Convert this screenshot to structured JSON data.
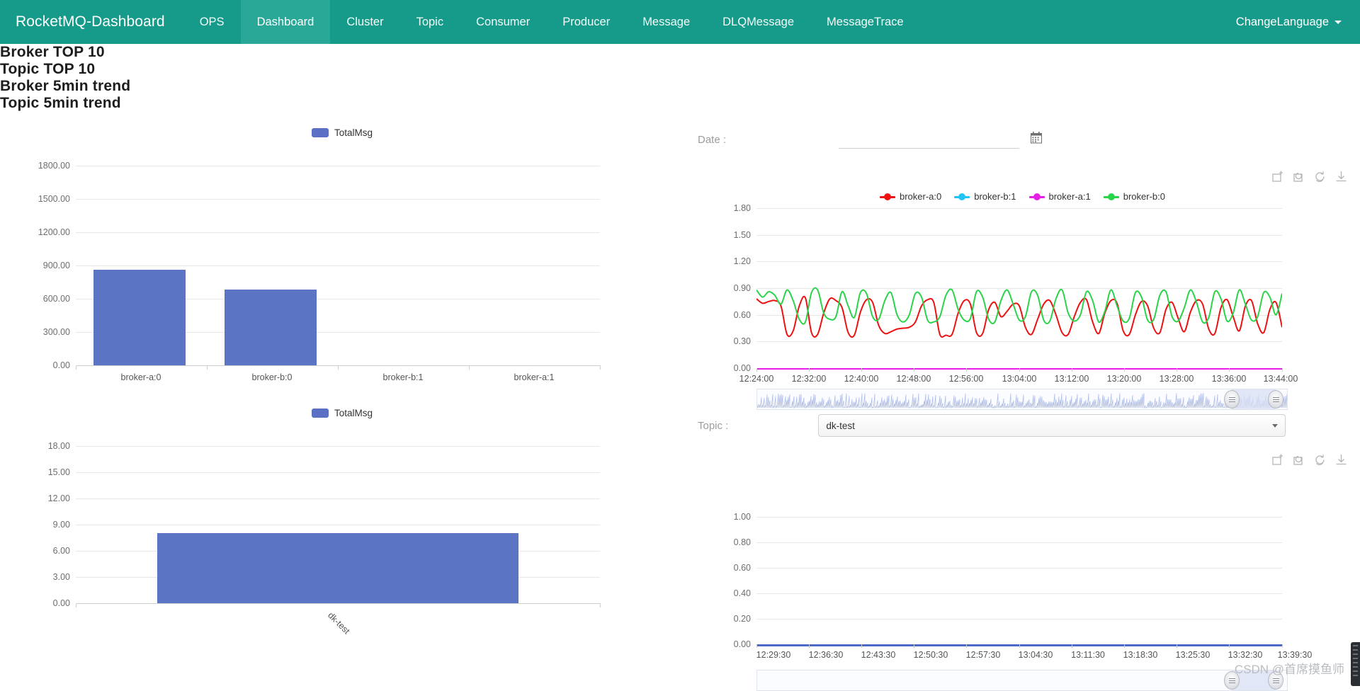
{
  "navbar": {
    "brand": "RocketMQ-Dashboard",
    "items": [
      {
        "label": "OPS",
        "active": false
      },
      {
        "label": "Dashboard",
        "active": true
      },
      {
        "label": "Cluster",
        "active": false
      },
      {
        "label": "Topic",
        "active": false
      },
      {
        "label": "Consumer",
        "active": false
      },
      {
        "label": "Producer",
        "active": false
      },
      {
        "label": "Message",
        "active": false
      },
      {
        "label": "DLQMessage",
        "active": false
      },
      {
        "label": "MessageTrace",
        "active": false
      }
    ],
    "language_label": "ChangeLanguage",
    "brand_color": "#169b8a",
    "active_color": "#2aa897"
  },
  "controls": {
    "date_label": "Date :",
    "date_value": "",
    "date_placeholder": "",
    "calendar_icon": "calendar-icon",
    "topic_label": "Topic :",
    "topic_value": "dk-test"
  },
  "toolbox": {
    "icons": [
      "zoom-area-icon",
      "zoom-restore-icon",
      "refresh-icon",
      "download-icon"
    ]
  },
  "chart_data": [
    {
      "id": "broker-top10",
      "type": "bar",
      "title": "Broker TOP 10",
      "legend": [
        "TotalMsg"
      ],
      "legend_color": "#5b74c4",
      "categories": [
        "broker-a:0",
        "broker-b:0",
        "broker-b:1",
        "broker-a:1"
      ],
      "values": [
        860,
        680,
        0,
        0
      ],
      "yticks": [
        "0.00",
        "300.00",
        "600.00",
        "900.00",
        "1200.00",
        "1500.00",
        "1800.00"
      ],
      "ylim": [
        0,
        1800
      ],
      "xlabel": "",
      "ylabel": "",
      "grid": true,
      "legend_position": "top-center"
    },
    {
      "id": "topic-top10",
      "type": "bar",
      "title": "Topic TOP 10",
      "legend": [
        "TotalMsg"
      ],
      "legend_color": "#5b74c4",
      "categories": [
        "dk-test"
      ],
      "values": [
        8
      ],
      "yticks": [
        "0.00",
        "3.00",
        "6.00",
        "9.00",
        "12.00",
        "15.00",
        "18.00"
      ],
      "ylim": [
        0,
        18
      ],
      "xlabel": "",
      "ylabel": "",
      "grid": true,
      "label_rotation": 45,
      "legend_position": "top-center"
    },
    {
      "id": "broker-5min-trend",
      "type": "line",
      "title": "Broker 5min trend",
      "yticks": [
        "0.00",
        "0.30",
        "0.60",
        "0.90",
        "1.20",
        "1.50",
        "1.80"
      ],
      "ylim": [
        0,
        1.8
      ],
      "xticks": [
        "12:24:00",
        "12:32:00",
        "12:40:00",
        "12:48:00",
        "12:56:00",
        "13:04:00",
        "13:12:00",
        "13:20:00",
        "13:28:00",
        "13:36:00",
        "13:44:00"
      ],
      "grid": true,
      "legend_position": "top-center",
      "series": [
        {
          "name": "broker-a:0",
          "color": "#ee1111",
          "values": [
            0.78,
            0.73,
            0.75,
            0.76,
            0.7,
            0.38,
            0.42,
            0.7,
            0.79,
            0.4,
            0.38,
            0.62,
            0.78,
            0.76,
            0.68,
            0.4,
            0.37,
            0.63,
            0.77,
            0.74,
            0.48,
            0.39,
            0.41,
            0.44,
            0.45,
            0.46,
            0.52,
            0.7,
            0.77,
            0.74,
            0.38,
            0.37,
            0.38,
            0.62,
            0.76,
            0.72,
            0.4,
            0.39,
            0.66,
            0.74,
            0.58,
            0.64,
            0.72,
            0.7,
            0.46,
            0.38,
            0.55,
            0.72,
            0.76,
            0.6,
            0.4,
            0.38,
            0.58,
            0.74,
            0.77,
            0.52,
            0.39,
            0.62,
            0.76,
            0.73,
            0.42,
            0.38,
            0.6,
            0.75,
            0.7,
            0.45,
            0.4,
            0.66,
            0.74,
            0.56,
            0.41,
            0.63,
            0.76,
            0.72,
            0.44,
            0.39,
            0.68,
            0.77,
            0.58,
            0.42,
            0.7,
            0.76,
            0.5,
            0.4,
            0.66,
            0.74,
            0.46
          ]
        },
        {
          "name": "broker-b:1",
          "color": "#22c3f5",
          "values": [
            0,
            0,
            0,
            0,
            0,
            0,
            0,
            0,
            0,
            0,
            0,
            0,
            0,
            0,
            0,
            0,
            0,
            0,
            0,
            0,
            0,
            0,
            0,
            0,
            0,
            0,
            0,
            0,
            0,
            0,
            0,
            0,
            0,
            0,
            0,
            0,
            0,
            0,
            0,
            0,
            0,
            0,
            0,
            0,
            0,
            0,
            0,
            0,
            0,
            0,
            0,
            0,
            0,
            0,
            0,
            0,
            0,
            0,
            0,
            0,
            0,
            0,
            0,
            0,
            0,
            0,
            0,
            0,
            0,
            0,
            0,
            0,
            0,
            0,
            0,
            0,
            0,
            0,
            0,
            0,
            0,
            0,
            0,
            0,
            0,
            0,
            0
          ]
        },
        {
          "name": "broker-a:1",
          "color": "#e61ee6",
          "values": [
            0,
            0,
            0,
            0,
            0,
            0,
            0,
            0,
            0,
            0,
            0,
            0,
            0,
            0,
            0,
            0,
            0,
            0,
            0,
            0,
            0,
            0,
            0,
            0,
            0,
            0,
            0,
            0,
            0,
            0,
            0,
            0,
            0,
            0,
            0,
            0,
            0,
            0,
            0,
            0,
            0,
            0,
            0,
            0,
            0,
            0,
            0,
            0,
            0,
            0,
            0,
            0,
            0,
            0,
            0,
            0,
            0,
            0,
            0,
            0,
            0,
            0,
            0,
            0,
            0,
            0,
            0,
            0,
            0,
            0,
            0,
            0,
            0,
            0,
            0,
            0,
            0,
            0,
            0,
            0,
            0,
            0,
            0,
            0,
            0,
            0,
            0
          ]
        },
        {
          "name": "broker-b:0",
          "color": "#2ad44a",
          "values": [
            0.88,
            0.8,
            0.86,
            0.82,
            0.72,
            0.88,
            0.76,
            0.55,
            0.52,
            0.85,
            0.88,
            0.62,
            0.55,
            0.58,
            0.86,
            0.7,
            0.57,
            0.85,
            0.84,
            0.58,
            0.55,
            0.76,
            0.85,
            0.6,
            0.52,
            0.6,
            0.84,
            0.8,
            0.54,
            0.52,
            0.58,
            0.82,
            0.88,
            0.66,
            0.54,
            0.56,
            0.86,
            0.8,
            0.55,
            0.52,
            0.76,
            0.88,
            0.72,
            0.54,
            0.58,
            0.86,
            0.82,
            0.54,
            0.53,
            0.78,
            0.88,
            0.62,
            0.53,
            0.6,
            0.86,
            0.76,
            0.52,
            0.64,
            0.88,
            0.7,
            0.53,
            0.56,
            0.85,
            0.8,
            0.54,
            0.55,
            0.82,
            0.86,
            0.58,
            0.53,
            0.68,
            0.88,
            0.74,
            0.52,
            0.57,
            0.86,
            0.78,
            0.53,
            0.62,
            0.88,
            0.72,
            0.54,
            0.58,
            0.85,
            0.8,
            0.6,
            0.84
          ]
        }
      ]
    },
    {
      "id": "topic-5min-trend",
      "type": "line",
      "title": "Topic 5min trend",
      "yticks": [
        "0.00",
        "0.20",
        "0.40",
        "0.60",
        "0.80",
        "1.00"
      ],
      "ylim": [
        0,
        1.0
      ],
      "xticks": [
        "12:29:30",
        "12:36:30",
        "12:43:30",
        "12:50:30",
        "12:57:30",
        "13:04:30",
        "13:11:30",
        "13:18:30",
        "13:25:30",
        "13:32:30",
        "13:39:30"
      ],
      "grid": true,
      "series": [
        {
          "name": "dk-test",
          "color": "#4a6ac8",
          "values": [
            0,
            0,
            0,
            0,
            0,
            0,
            0,
            0,
            0,
            0,
            0,
            0,
            0,
            0,
            0,
            0,
            0,
            0,
            0,
            0,
            0,
            0,
            0,
            0,
            0,
            0,
            0,
            0,
            0,
            0,
            0,
            0,
            0,
            0,
            0,
            0,
            0,
            0,
            0,
            0
          ]
        }
      ]
    }
  ],
  "watermark": "CSDN @首席摸鱼师"
}
